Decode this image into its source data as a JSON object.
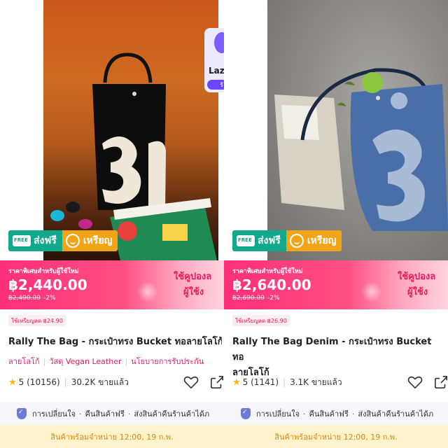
{
  "products": [
    {
      "overlay": {
        "label": "Laz",
        "pill": "รั"
      },
      "badges": {
        "free_shipping": "ส่งฟรี",
        "coins": "เหรียญ"
      },
      "price_banner": {
        "label": "ราคาพิเศษสำหรับผู้ใช้ใหม่",
        "price": "฿2,440.00",
        "original_price": "฿2,490.00",
        "discount": "-2%",
        "coupon_line1": "ใช้คูปองล",
        "coupon_line2": "ผู้ใช้ง"
      },
      "coin_tag": "ใช้เหรียญลด ฿24.90",
      "title": "Rally The Bag - กระเป๋าทรง Bucket ทอลายโลโก้",
      "attributes": [
        "ลายโลโก้",
        "วัสดุ Vegan Leather",
        "นโยบายการรับประกัน"
      ],
      "rating": {
        "score": "5",
        "count": "(10156)",
        "sold": "30.2K ขายแล้ว"
      },
      "guarantee": [
        "การเปลี่ยนใจ",
        "คืนสินค้าฟรี",
        "ส่งสินค้าคืนร้านค้าได้ภ"
      ],
      "availability": "สินค้าพร้อมจำหน่าย 12:00, 19 ก.พ."
    },
    {
      "badges": {
        "free_shipping": "ส่งฟรี",
        "coins": "เหรียญ"
      },
      "price_banner": {
        "label": "ราคาพิเศษสำหรับผู้ใช้ใหม่",
        "price": "฿2,640.00",
        "original_price": "฿2,690.00",
        "discount": "-2%",
        "coupon_line1": "ใช้คูปองล",
        "coupon_line2": "ผู้ใช้ง"
      },
      "coin_tag": "ใช้เหรียญลด ฿26.90",
      "title_line1": "Rally The Bag Denim - กระเป๋าทรง Bucket ทอ",
      "title_line2": "ลายโลโก้",
      "rating": {
        "score": "5",
        "count": "(1141)",
        "sold": "3.1K ขายแล้ว"
      },
      "guarantee": [
        "การเปลี่ยนใจ",
        "คืนสินค้าฟรี",
        "ส่งสินค้าคืนร้านค้าได้ภ"
      ],
      "availability": "สินค้าพร้อมจำหน่าย 12:00, 19 ก.พ."
    }
  ],
  "colors": {
    "free_badge": "#12a88b",
    "coin_badge": "#f0a418",
    "price_pink": "#ff2e7a",
    "accent": "#e0205e",
    "availability_bg": "#fff3cf"
  },
  "icons": [
    "truck-icon",
    "coin-smile-icon",
    "star-icon",
    "heart-icon",
    "share-icon",
    "shield-check-icon"
  ]
}
